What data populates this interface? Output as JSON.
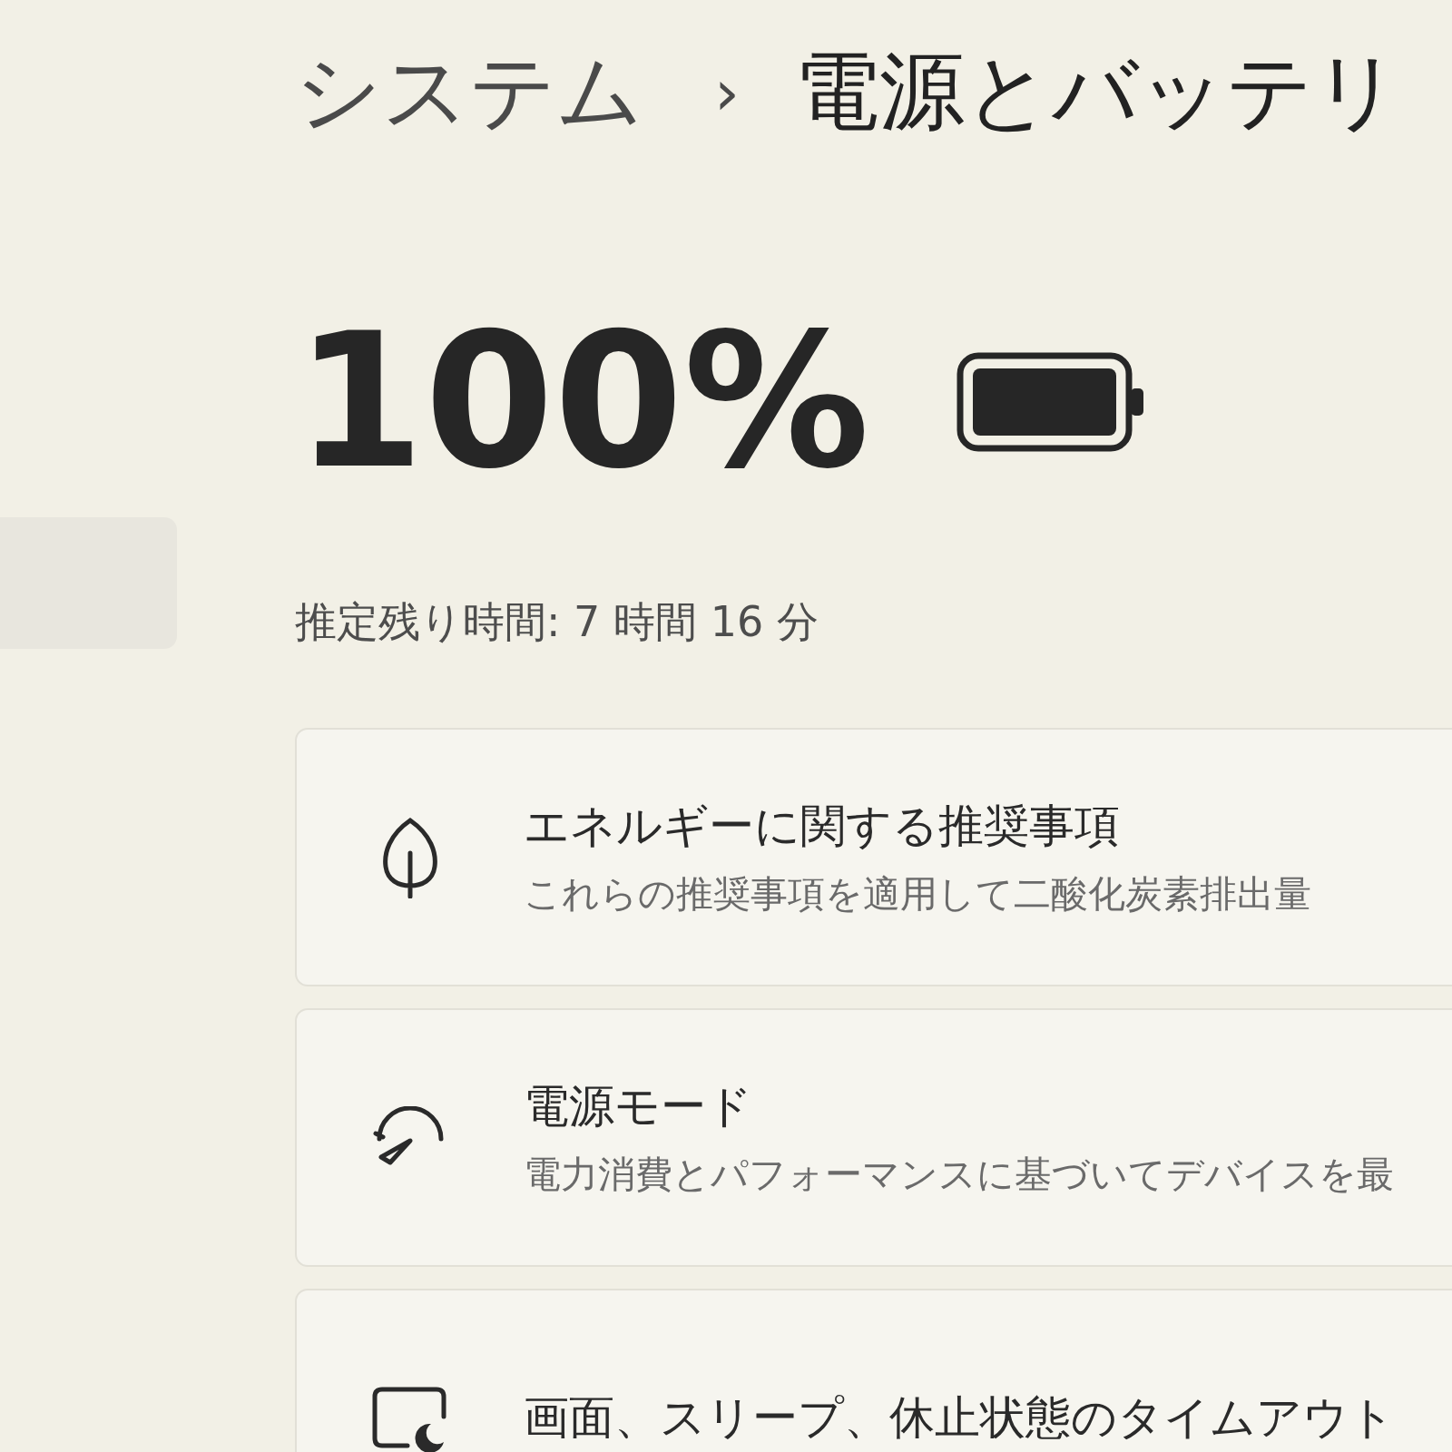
{
  "breadcrumb": {
    "parent": "システム",
    "separator": "›",
    "current": "電源とバッテリ"
  },
  "battery": {
    "percent": "100%",
    "remaining": "推定残り時間: 7 時間 16 分"
  },
  "cards": [
    {
      "kind": "leaf",
      "title": "エネルギーに関する推奨事項",
      "description": "これらの推奨事項を適用して二酸化炭素排出量"
    },
    {
      "kind": "gauge",
      "title": "電源モード",
      "description": "電力消費とパフォーマンスに基づいてデバイスを最"
    },
    {
      "kind": "screen",
      "title": "画面、スリープ、休止状態のタイムアウト"
    }
  ]
}
